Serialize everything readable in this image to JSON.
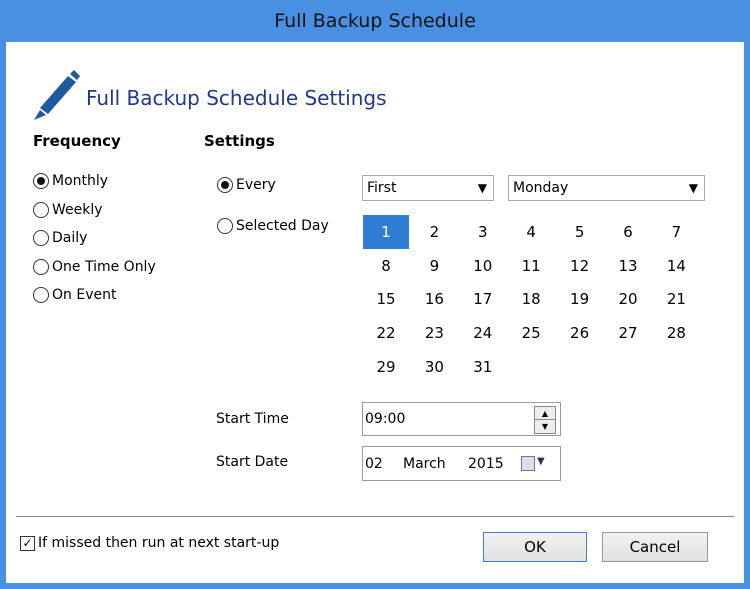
{
  "window": {
    "title": "Full Backup Schedule"
  },
  "header": {
    "title": "Full Backup Schedule Settings",
    "icon": "pencil-icon"
  },
  "frequency": {
    "label": "Frequency",
    "options": [
      {
        "label": "Monthly",
        "selected": true
      },
      {
        "label": "Weekly",
        "selected": false
      },
      {
        "label": "Daily",
        "selected": false
      },
      {
        "label": "One Time Only",
        "selected": false
      },
      {
        "label": "On Event",
        "selected": false
      }
    ]
  },
  "settings": {
    "label": "Settings",
    "every_label": "Every",
    "selected_day_label": "Selected Day",
    "mode": "Every",
    "ordinal_select": "First",
    "weekday_select": "Monday",
    "days": [
      "1",
      "2",
      "3",
      "4",
      "5",
      "6",
      "7",
      "8",
      "9",
      "10",
      "11",
      "12",
      "13",
      "14",
      "15",
      "16",
      "17",
      "18",
      "19",
      "20",
      "21",
      "22",
      "23",
      "24",
      "25",
      "26",
      "27",
      "28",
      "29",
      "30",
      "31"
    ],
    "selected_day": "1",
    "start_time_label": "Start Time",
    "start_time": "09:00",
    "start_date_label": "Start Date",
    "start_date": {
      "day": "02",
      "month": "March",
      "year": "2015"
    }
  },
  "footer": {
    "missed_label": "If missed then run at next start-up",
    "missed_checked": true,
    "ok_label": "OK",
    "cancel_label": "Cancel"
  },
  "colors": {
    "frame": "#4a90e2",
    "accent": "#2e7fd3",
    "header_text": "#1f3a8a"
  }
}
